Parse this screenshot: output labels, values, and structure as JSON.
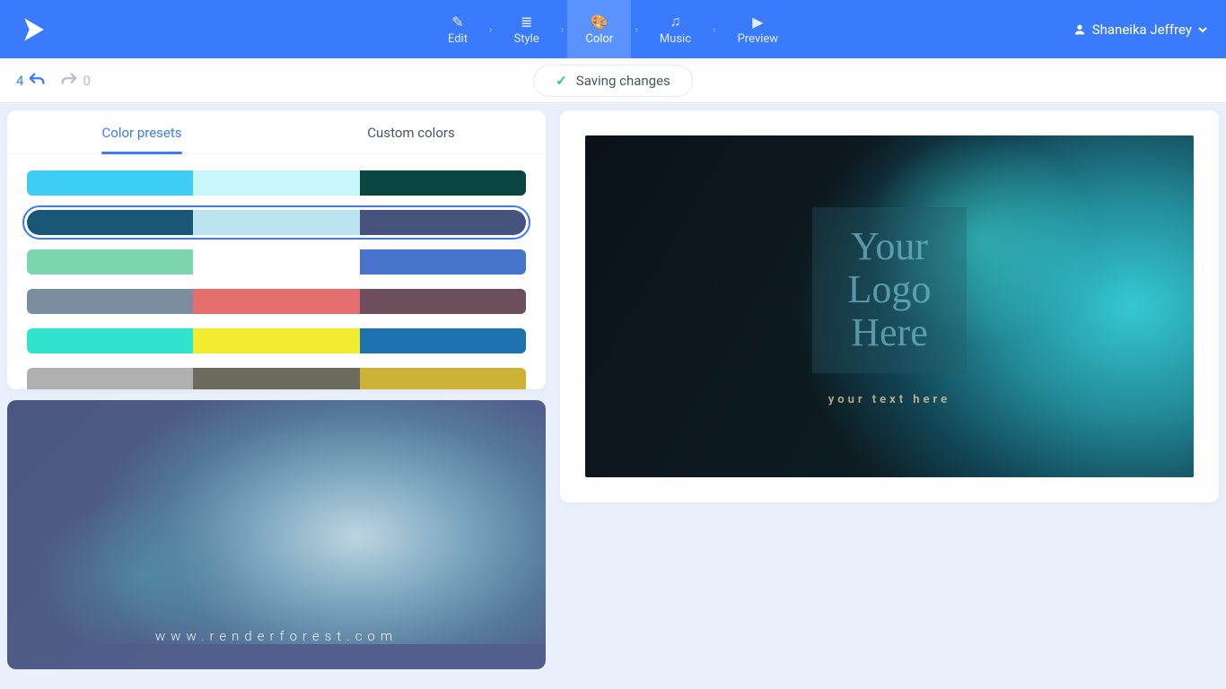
{
  "header": {
    "steps": [
      {
        "id": "edit",
        "label": "Edit"
      },
      {
        "id": "style",
        "label": "Style"
      },
      {
        "id": "color",
        "label": "Color"
      },
      {
        "id": "music",
        "label": "Music"
      },
      {
        "id": "preview",
        "label": "Preview"
      }
    ],
    "active_step": "color",
    "user_name": "Shaneika Jeffrey"
  },
  "toolbar": {
    "undo_count": "4",
    "redo_count": "0",
    "save_status": "Saving changes"
  },
  "color_panel": {
    "tabs": {
      "presets": "Color presets",
      "custom": "Custom colors"
    },
    "active_tab": "presets",
    "selected_index": 1,
    "presets": [
      [
        "#3dcdf5",
        "#c9f6f8",
        "#0b4542"
      ],
      [
        "#1a5776",
        "#bce3f0",
        "#47527e"
      ],
      [
        "#7bd5ad",
        "#ffffff",
        "#4974cb"
      ],
      [
        "#7c8da0",
        "#e46e6e",
        "#6c4e5d"
      ],
      [
        "#2fe3cf",
        "#f1eb2f",
        "#1f72b0"
      ],
      [
        "#b0b0b0",
        "#6a6a5d",
        "#cdb237"
      ]
    ]
  },
  "preview_small": {
    "url_text": "www.renderforest.com"
  },
  "preview_large": {
    "logo_line1": "Your",
    "logo_line2": "Logo",
    "logo_line3": "Here",
    "subtext": "your text here"
  }
}
